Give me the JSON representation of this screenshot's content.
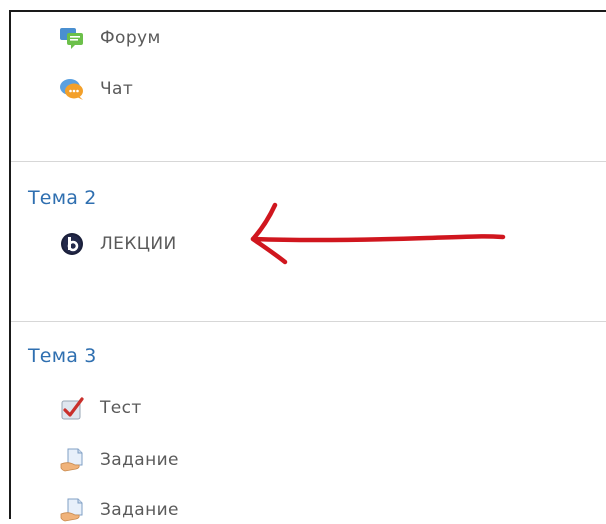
{
  "sections": [
    {
      "activities": [
        {
          "label": "Форум",
          "icon": "forum-icon"
        },
        {
          "label": "Чат",
          "icon": "chat-icon"
        }
      ]
    },
    {
      "title": "Тема 2",
      "activities": [
        {
          "label": "ЛЕКЦИИ",
          "icon": "bigbluebutton-icon"
        }
      ]
    },
    {
      "title": "Тема 3",
      "activities": [
        {
          "label": "Тест",
          "icon": "quiz-icon"
        },
        {
          "label": "Задание",
          "icon": "assignment-icon"
        },
        {
          "label": "Задание",
          "icon": "assignment-icon"
        }
      ]
    }
  ],
  "annotation": {
    "color": "#d0161e"
  },
  "colors": {
    "section_title": "#2f6fb0",
    "activity_text": "#5a5a5a",
    "divider": "#d7d7d7"
  }
}
